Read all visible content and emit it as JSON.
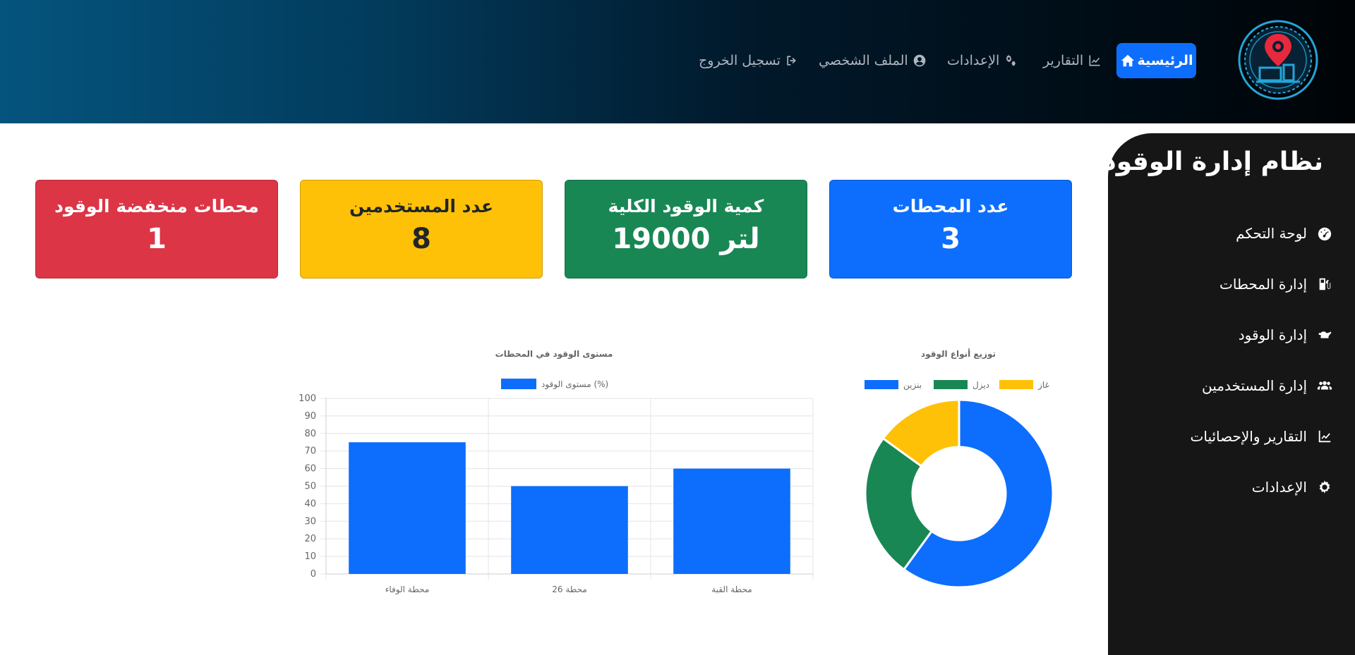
{
  "nav": {
    "home": "الرئيسية",
    "reports": "التقارير",
    "settings": "الإعدادات",
    "profile": "الملف الشخصي",
    "logout": "تسجيل الخروج"
  },
  "sidebar": {
    "title": "نظام إدارة الوقود",
    "items": [
      {
        "label": "لوحة التحكم",
        "icon": "gauge-icon"
      },
      {
        "label": "إدارة المحطات",
        "icon": "gas-pump-icon"
      },
      {
        "label": "إدارة الوقود",
        "icon": "oil-can-icon"
      },
      {
        "label": "إدارة المستخدمين",
        "icon": "users-icon"
      },
      {
        "label": "التقارير والإحصائيات",
        "icon": "chart-line-icon"
      },
      {
        "label": "الإعدادات",
        "icon": "gear-icon"
      }
    ]
  },
  "cards": [
    {
      "title": "عدد المحطات",
      "value": "3",
      "color": "#0d6efd"
    },
    {
      "title": "كمية الوقود الكلية",
      "value": "19000 لتر",
      "color": "#198754"
    },
    {
      "title": "عدد المستخدمين",
      "value": "8",
      "color": "#ffc107"
    },
    {
      "title": "محطات منخفضة الوقود",
      "value": "1",
      "color": "#dc3545"
    }
  ],
  "chart_data": [
    {
      "type": "pie",
      "variant": "doughnut",
      "title": "توزيع أنواع الوقود",
      "labels": [
        "بنزين",
        "ديزل",
        "غاز"
      ],
      "values": [
        60,
        25,
        15
      ],
      "colors": [
        "#0d6efd",
        "#198754",
        "#ffc107"
      ],
      "legend": "top"
    },
    {
      "type": "bar",
      "title": "مستوى الوقود في المحطات",
      "categories": [
        "محطة القبة",
        "محطة 26",
        "محطة الوفاء"
      ],
      "series": [
        {
          "name": "مستوى الوقود (%)",
          "values": [
            60,
            50,
            75
          ]
        }
      ],
      "ylim": [
        0,
        100
      ],
      "yticks": [
        0,
        10,
        20,
        30,
        40,
        50,
        60,
        70,
        80,
        90,
        100
      ],
      "grid": true,
      "legend": "top",
      "color": "#0d6efd"
    }
  ]
}
